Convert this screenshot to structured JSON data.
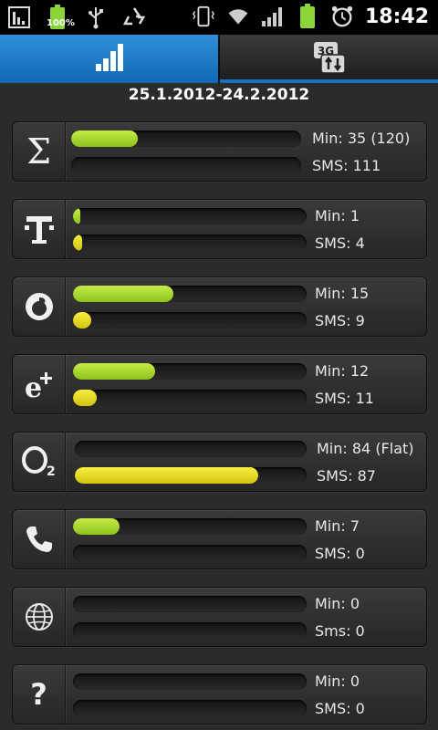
{
  "status_bar": {
    "battery_percent": "100%",
    "time": "18:42"
  },
  "tabs": [
    {
      "name": "usage-stats",
      "icon": "bar-chart-icon",
      "active": true
    },
    {
      "name": "data-3g",
      "icon": "3g-data-icon",
      "active": false
    }
  ],
  "date_range": "25.1.2012-24.2.2012",
  "rows": [
    {
      "icon": "sigma-icon",
      "min_label": "Min: 35 (120)",
      "sms_label": "SMS: 111",
      "min_fill": 0.29,
      "sms_fill": 0.0
    },
    {
      "icon": "t-mobile-icon",
      "min_label": "Min: 1",
      "sms_label": "SMS: 4",
      "min_fill": 0.03,
      "sms_fill": 0.04
    },
    {
      "icon": "vodafone-icon",
      "min_label": "Min: 15",
      "sms_label": "SMS: 9",
      "min_fill": 0.43,
      "sms_fill": 0.08
    },
    {
      "icon": "eplus-icon",
      "min_label": "Min: 12",
      "sms_label": "SMS: 11",
      "min_fill": 0.35,
      "sms_fill": 0.1
    },
    {
      "icon": "o2-icon",
      "min_label": "Min: 84 (Flat)",
      "sms_label": "SMS: 87",
      "min_fill": 0.0,
      "sms_fill": 0.79
    },
    {
      "icon": "phone-icon",
      "min_label": "Min: 7",
      "sms_label": "SMS: 0",
      "min_fill": 0.2,
      "sms_fill": 0.0
    },
    {
      "icon": "globe-icon",
      "min_label": "Min: 0",
      "sms_label": "Sms: 0",
      "min_fill": 0.0,
      "sms_fill": 0.0
    },
    {
      "icon": "question-icon",
      "min_label": "Min: 0",
      "sms_label": "SMS: 0",
      "min_fill": 0.0,
      "sms_fill": 0.0
    }
  ],
  "colors": {
    "min_fill": "#a6d62c",
    "sms_fill": "#e8dc1e",
    "tab_active": "#1f7cc8"
  }
}
